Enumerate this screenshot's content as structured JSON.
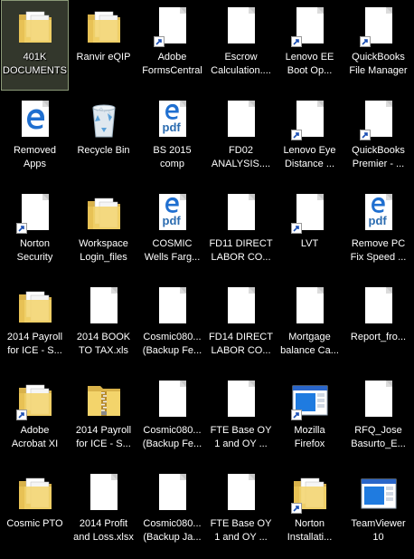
{
  "desktop": {
    "selected_index": 0,
    "items": [
      {
        "label": "401K\nDOCUMENTS",
        "icon": "folder-documents-icon",
        "shortcut": false,
        "selected": true
      },
      {
        "label": "Ranvir eQIP",
        "icon": "folder-documents-icon",
        "shortcut": false
      },
      {
        "label": "Adobe\nFormsCentral",
        "icon": "file-icon",
        "shortcut": true
      },
      {
        "label": "Escrow\nCalculation....",
        "icon": "file-icon",
        "shortcut": false
      },
      {
        "label": "Lenovo EE\nBoot Op...",
        "icon": "file-icon",
        "shortcut": true
      },
      {
        "label": "QuickBooks\nFile Manager",
        "icon": "file-icon",
        "shortcut": true
      },
      {
        "label": "Removed\nApps",
        "icon": "edge-icon",
        "shortcut": false
      },
      {
        "label": "Recycle Bin",
        "icon": "recycle-bin-icon",
        "shortcut": false
      },
      {
        "label": "BS 2015\ncomp",
        "icon": "edge-pdf-icon",
        "shortcut": false
      },
      {
        "label": "FD02\nANALYSIS....",
        "icon": "file-icon",
        "shortcut": false
      },
      {
        "label": "Lenovo Eye\nDistance ...",
        "icon": "file-icon",
        "shortcut": true
      },
      {
        "label": "QuickBooks\nPremier - ...",
        "icon": "file-icon",
        "shortcut": true
      },
      {
        "label": "Norton\nSecurity",
        "icon": "file-icon",
        "shortcut": true
      },
      {
        "label": "Workspace\nLogin_files",
        "icon": "folder-documents-icon",
        "shortcut": false
      },
      {
        "label": "COSMIC\nWells Farg...",
        "icon": "edge-pdf-icon",
        "shortcut": false
      },
      {
        "label": "FD11 DIRECT\nLABOR CO...",
        "icon": "file-icon",
        "shortcut": false
      },
      {
        "label": "LVT",
        "icon": "file-icon",
        "shortcut": true
      },
      {
        "label": "Remove PC\nFix Speed ...",
        "icon": "edge-pdf-icon",
        "shortcut": false
      },
      {
        "label": "2014 Payroll\nfor ICE - S...",
        "icon": "folder-documents-icon",
        "shortcut": false
      },
      {
        "label": "2014 BOOK\nTO TAX.xls",
        "icon": "file-icon",
        "shortcut": false
      },
      {
        "label": "Cosmic080...\n(Backup Fe...",
        "icon": "file-icon",
        "shortcut": false
      },
      {
        "label": "FD14 DIRECT\nLABOR CO...",
        "icon": "file-icon",
        "shortcut": false
      },
      {
        "label": "Mortgage\nbalance Ca...",
        "icon": "file-icon",
        "shortcut": false
      },
      {
        "label": "Report_fro...",
        "icon": "file-icon",
        "shortcut": false
      },
      {
        "label": "Adobe\nAcrobat XI",
        "icon": "folder-documents-icon",
        "shortcut": true
      },
      {
        "label": "2014 Payroll\nfor ICE - S...",
        "icon": "zip-folder-icon",
        "shortcut": false
      },
      {
        "label": "Cosmic080...\n(Backup Fe...",
        "icon": "file-icon",
        "shortcut": false
      },
      {
        "label": "FTE Base OY\n1 and OY ...",
        "icon": "file-icon",
        "shortcut": false
      },
      {
        "label": "Mozilla\nFirefox",
        "icon": "window-app-icon",
        "shortcut": true
      },
      {
        "label": "RFQ_Jose\nBasurto_E...",
        "icon": "file-icon",
        "shortcut": false
      },
      {
        "label": "Cosmic PTO",
        "icon": "folder-documents-icon",
        "shortcut": false
      },
      {
        "label": "2014 Profit\nand Loss.xlsx",
        "icon": "file-icon",
        "shortcut": false
      },
      {
        "label": "Cosmic080...\n(Backup Ja...",
        "icon": "file-icon",
        "shortcut": false
      },
      {
        "label": "FTE Base OY\n1 and OY ...",
        "icon": "file-icon",
        "shortcut": false
      },
      {
        "label": "Norton\nInstallati...",
        "icon": "folder-documents-icon",
        "shortcut": true
      },
      {
        "label": "TeamViewer\n10",
        "icon": "window-app-icon",
        "shortcut": false
      }
    ]
  },
  "colors": {
    "background": "#000000",
    "selection": "#5c6450",
    "folder": "#f3d46b",
    "edge_blue": "#1f6fd0"
  }
}
